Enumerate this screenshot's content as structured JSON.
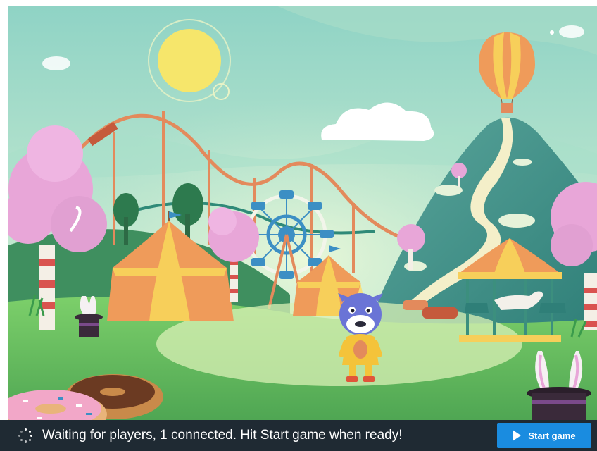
{
  "scene": {
    "title": "",
    "icons": [
      "sun-icon",
      "cloud-icon",
      "hot-air-balloon-icon",
      "roller-coaster-icon",
      "ferris-wheel-icon",
      "circus-tent-icon",
      "carousel-icon",
      "cotton-candy-tree-icon",
      "magic-hat-bunny-icon",
      "donut-icon",
      "unicorn-character-icon",
      "mountain-icon"
    ],
    "colors": {
      "sky_top": "#8fd3c5",
      "sky_bottom": "#c9ecd0",
      "grass": "#6cc15f",
      "cotton_candy": "#e8a6d8",
      "tent_orange": "#ef9b5a",
      "tent_yellow": "#f7cf5a",
      "coaster_track": "#e38a5c",
      "ferris_blue": "#3c8fc4"
    }
  },
  "status": {
    "message": "Waiting for players, 1 connected. Hit Start game when ready!",
    "start_label": "Start game"
  },
  "theme": {
    "status_bar_bg": "#1f2a33",
    "start_button_bg": "#1a8ce0"
  }
}
